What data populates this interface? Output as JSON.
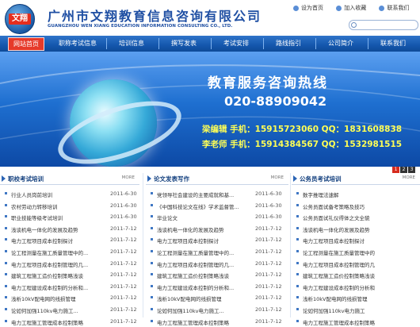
{
  "header": {
    "company_cn": "广州市文翔教育信息咨询有限公司",
    "company_en": "GUANGZHOU WEN XIANG EDUCATION INFORMATION CONSULTING CO., LTD.",
    "logo_text": "文翔",
    "links": [
      "设为首页",
      "加入收藏",
      "联系我们"
    ]
  },
  "nav": {
    "items": [
      "网站首页",
      "职称考试信息",
      "培训信息",
      "撰写发表",
      "考试安排",
      "路线指引",
      "公司简介",
      "联系我们"
    ]
  },
  "banner": {
    "title": "教育服务咨询热线",
    "phone": "020-88909042",
    "contact1": "梁编辑  手机：15915723060  QQ：1831608838",
    "contact2": "李老师  手机：15914384567  QQ：1532981515",
    "dots": [
      "1",
      "2",
      "3"
    ]
  },
  "columns": [
    {
      "title": "职校考试培训",
      "more": "MORE",
      "items": [
        {
          "text": "行业人员岗前培训",
          "date": "2011-6-30"
        },
        {
          "text": "农村劳动力转移培训",
          "date": "2011-6-30"
        },
        {
          "text": "职业技能等级考试培训",
          "date": "2011-6-30"
        },
        {
          "text": "浅谈机电一体化的发展及趋势",
          "date": "2011-7-12"
        },
        {
          "text": "电力工程项目成本控制探讨",
          "date": "2011-7-12"
        },
        {
          "text": "论工程测量在施工质量管理中的...",
          "date": "2011-7-12"
        },
        {
          "text": "电力工程项目成本控制管理的几...",
          "date": "2011-7-12"
        },
        {
          "text": "建筑工程施工造价控制策略浅谈",
          "date": "2011-7-12"
        },
        {
          "text": "电力工程建设成本控制的分析和...",
          "date": "2011-7-12"
        },
        {
          "text": "浅析10kV配电网的线损管理",
          "date": "2011-7-12"
        },
        {
          "text": "论如何加强110kv电力施工...",
          "date": "2011-7-12"
        },
        {
          "text": "电力工程施工管理成本控制策略",
          "date": "2011-7-12"
        }
      ]
    },
    {
      "title": "论文发表写作",
      "more": "MORE",
      "items": [
        {
          "text": "党领导社会建设的主要成就和基...",
          "date": "2011-6-30"
        },
        {
          "text": "《中国科技论文在线》学术监督管...",
          "date": "2011-6-30"
        },
        {
          "text": "毕业论文",
          "date": "2011-6-30"
        },
        {
          "text": "浅谈机电一体化的发展及趋势",
          "date": "2011-7-12"
        },
        {
          "text": "电力工程项目成本控制探讨",
          "date": "2011-7-12"
        },
        {
          "text": "论工程测量在施工质量管理中的...",
          "date": "2011-7-12"
        },
        {
          "text": "电力工程项目成本控制管理的几...",
          "date": "2011-7-12"
        },
        {
          "text": "建筑工程施工造价控制策略浅谈",
          "date": "2011-7-12"
        },
        {
          "text": "电力工程建设成本控制的分析和...",
          "date": "2011-7-12"
        },
        {
          "text": "浅析10kV配电网的线损管理",
          "date": "2011-7-12"
        },
        {
          "text": "论如何加强110kv电力施工...",
          "date": "2011-7-12"
        },
        {
          "text": "电力工程施工管理成本控制策略",
          "date": "2011-7-12"
        }
      ]
    },
    {
      "title": "公务员考试培训",
      "more": "MORE",
      "items": [
        {
          "text": "数字推理法速解",
          "date": ""
        },
        {
          "text": "公务员面试备考策略及技巧",
          "date": ""
        },
        {
          "text": "公务员面试礼仪得体之文全貌",
          "date": ""
        },
        {
          "text": "浅谈机电一体化的发展及趋势",
          "date": ""
        },
        {
          "text": "电力工程项目成本控制探讨",
          "date": ""
        },
        {
          "text": "论工程测量在施工质量管理中的",
          "date": ""
        },
        {
          "text": "电力工程项目成本控制管理的几",
          "date": ""
        },
        {
          "text": "建筑工程施工造价控制策略浅谈",
          "date": ""
        },
        {
          "text": "电力工程建设成本控制的分析和",
          "date": ""
        },
        {
          "text": "浅析10kV配电网的线损管理",
          "date": ""
        },
        {
          "text": "论如何加强110kv电力施工",
          "date": ""
        },
        {
          "text": "电力工程施工管理成本控制策略",
          "date": ""
        }
      ]
    }
  ]
}
